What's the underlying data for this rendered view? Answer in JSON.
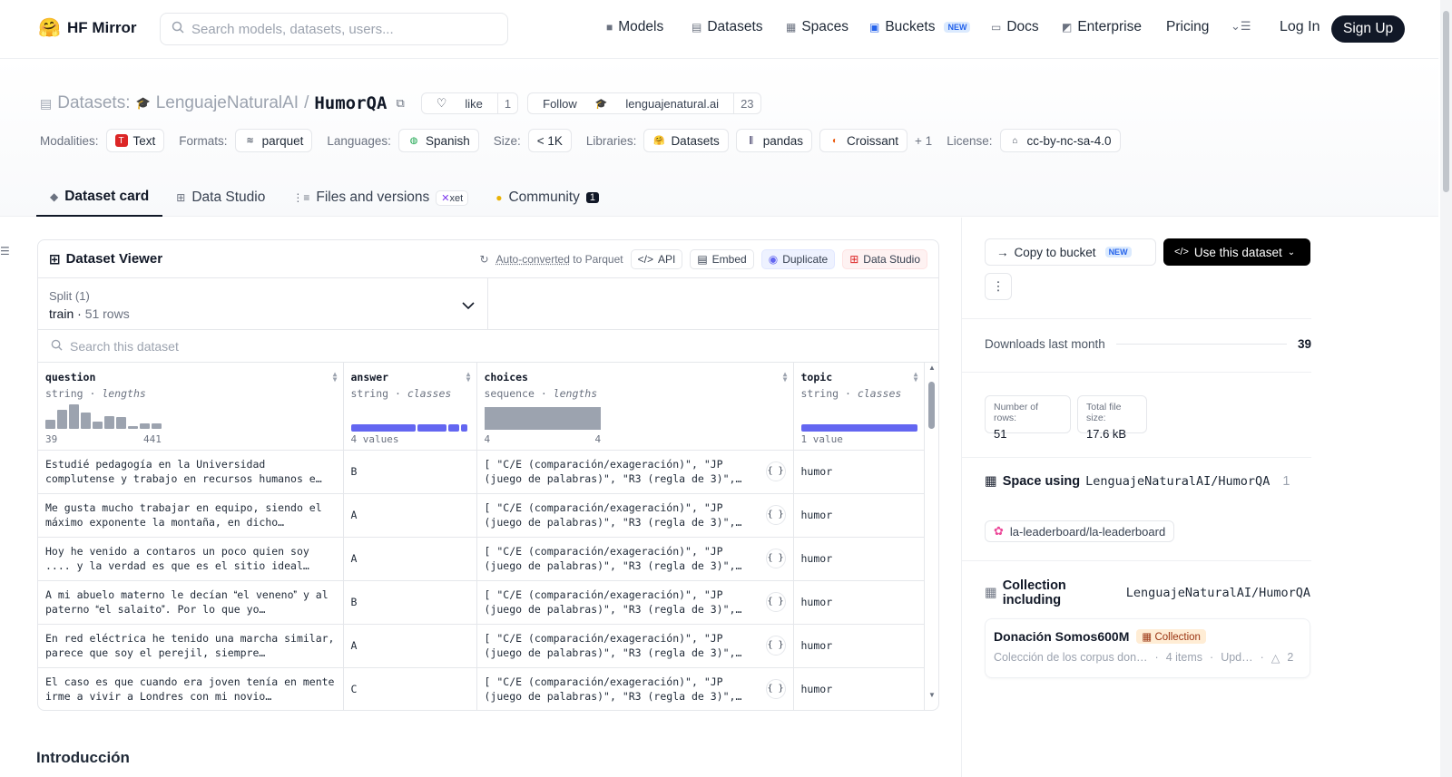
{
  "nav": {
    "brand": "HF Mirror",
    "search_placeholder": "Search models, datasets, users...",
    "items": [
      "Models",
      "Datasets",
      "Spaces",
      "Buckets",
      "Docs",
      "Enterprise",
      "Pricing"
    ],
    "new_badge": "NEW",
    "login": "Log In",
    "signup": "Sign Up"
  },
  "repo": {
    "kind": "Datasets:",
    "owner": "LenguajeNaturalAI",
    "sep": "/",
    "name": "HumorQA",
    "like_label": "like",
    "like_count": "1",
    "follow_label": "Follow",
    "follow_org": "lenguajenatural.ai",
    "follow_count": "23"
  },
  "meta": {
    "modalities_label": "Modalities:",
    "modality": "Text",
    "formats_label": "Formats:",
    "format": "parquet",
    "languages_label": "Languages:",
    "language": "Spanish",
    "size_label": "Size:",
    "size": "< 1K",
    "libraries_label": "Libraries:",
    "libraries": [
      "Datasets",
      "pandas",
      "Croissant"
    ],
    "libraries_more": "+ 1",
    "license_label": "License:",
    "license": "cc-by-nc-sa-4.0"
  },
  "tabs": {
    "dataset_card": "Dataset card",
    "data_studio": "Data Studio",
    "files": "Files and versions",
    "xet": "xet",
    "community": "Community",
    "community_count": "1"
  },
  "viewer": {
    "title": "Dataset Viewer",
    "auto_converted": "Auto-converted",
    "to_parquet": " to Parquet",
    "api": "API",
    "embed": "Embed",
    "duplicate": "Duplicate",
    "data_studio": "Data Studio",
    "split_label": "Split (1)",
    "split_name": "train",
    "split_rows": "51 rows",
    "search_placeholder": "Search this dataset",
    "columns": [
      {
        "name": "question",
        "type": "string",
        "stat": "lengths",
        "min": "39",
        "max": "441"
      },
      {
        "name": "answer",
        "type": "string",
        "stat": "classes",
        "summary": "4 values"
      },
      {
        "name": "choices",
        "type": "sequence",
        "stat": "lengths",
        "min": "4",
        "max": "4"
      },
      {
        "name": "topic",
        "type": "string",
        "stat": "classes",
        "summary": "1 value"
      }
    ],
    "histogram": [
      0.35,
      0.75,
      0.95,
      0.65,
      0.3,
      0.5,
      0.45,
      0.1,
      0.2,
      0.2
    ],
    "answer_classes": [
      0.58,
      0.26,
      0.1,
      0.06
    ],
    "rows": [
      {
        "question": "Estudié pedagogía en la Universidad complutense y trabajo en recursos humanos e…",
        "answer": "B",
        "choices": "[ \"C/E (comparación/exageración)\", \"JP (juego de palabras)\", \"R3 (regla de 3)\",…",
        "topic": "humor"
      },
      {
        "question": "Me gusta mucho trabajar en equipo, siendo el máximo exponente la montaña, en dicho…",
        "answer": "A",
        "choices": "[ \"C/E (comparación/exageración)\", \"JP (juego de palabras)\", \"R3 (regla de 3)\",…",
        "topic": "humor"
      },
      {
        "question": "Hoy he venido a contaros un poco quien soy .... y la verdad es que es el sitio ideal…",
        "answer": "A",
        "choices": "[ \"C/E (comparación/exageración)\", \"JP (juego de palabras)\", \"R3 (regla de 3)\",…",
        "topic": "humor"
      },
      {
        "question": "A mi abuelo materno le decían el veneno y al paterno el salaito. Por lo que yo…",
        "answer": "B",
        "choices": "[ \"C/E (comparación/exageración)\", \"JP (juego de palabras)\", \"R3 (regla de 3)\",…",
        "topic": "humor"
      },
      {
        "question": "En red eléctrica he tenido una marcha similar, parece que soy el perejil, siempre…",
        "answer": "A",
        "choices": "[ \"C/E (comparación/exageración)\", \"JP (juego de palabras)\", \"R3 (regla de 3)\",…",
        "topic": "humor"
      },
      {
        "question": "El caso es que cuando era joven tenía en mente irme a vivir a Londres con mi novio…",
        "answer": "C",
        "choices": "[ \"C/E (comparación/exageración)\", \"JP (juego de palabras)\", \"R3 (regla de 3)\",…",
        "topic": "humor"
      }
    ]
  },
  "intro_heading": "Introducción",
  "sidebar": {
    "copy_bucket": "Copy to bucket",
    "new_badge": "NEW",
    "use_dataset": "Use this dataset",
    "downloads_label": "Downloads last month",
    "downloads": "39",
    "rows_label": "Number of rows:",
    "rows_value": "51",
    "size_label": "Total file size:",
    "size_value": "17.6 kB",
    "space_using_label": "Space using",
    "space_using_repo": "LenguajeNaturalAI/HumorQA",
    "space_count": "1",
    "space_chip": "la-leaderboard/la-leaderboard",
    "collection_label": "Collection including",
    "collection_repo": "LenguajeNaturalAI/HumorQA",
    "collection_name": "Donación Somos600M",
    "collection_tag": "Collection",
    "collection_desc": "Colección de los corpus don…",
    "collection_items": "4 items",
    "collection_updated": "Upd…",
    "collection_upvotes": "2"
  }
}
